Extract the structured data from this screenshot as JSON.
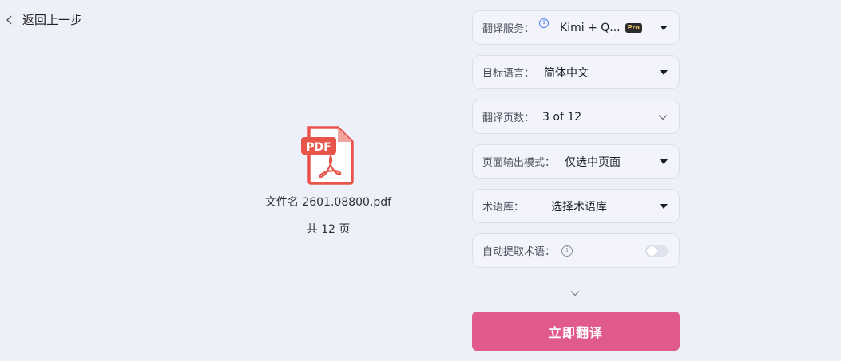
{
  "back": {
    "label": "返回上一步"
  },
  "file": {
    "name": "文件名 2601.08800.pdf",
    "pages": "共 12 页",
    "icon_text": "PDF"
  },
  "settings": {
    "service": {
      "label": "翻译服务：",
      "value": "Kimi + Q...",
      "badge": "Pro"
    },
    "target_language": {
      "label": "目标语言：",
      "value": "简体中文"
    },
    "page_range": {
      "label": "翻译页数：",
      "value": "3 of 12"
    },
    "output_mode": {
      "label": "页面输出模式：",
      "value": "仅选中页面"
    },
    "glossary": {
      "label": "术语库：",
      "value": "选择术语库"
    },
    "auto_extract": {
      "label": "自动提取术语：",
      "enabled": false
    }
  },
  "action": {
    "translate_label": "立即翻译"
  },
  "colors": {
    "background": "#eef0f9",
    "accent": "#e05a8b",
    "pdf_red": "#e8534a"
  }
}
